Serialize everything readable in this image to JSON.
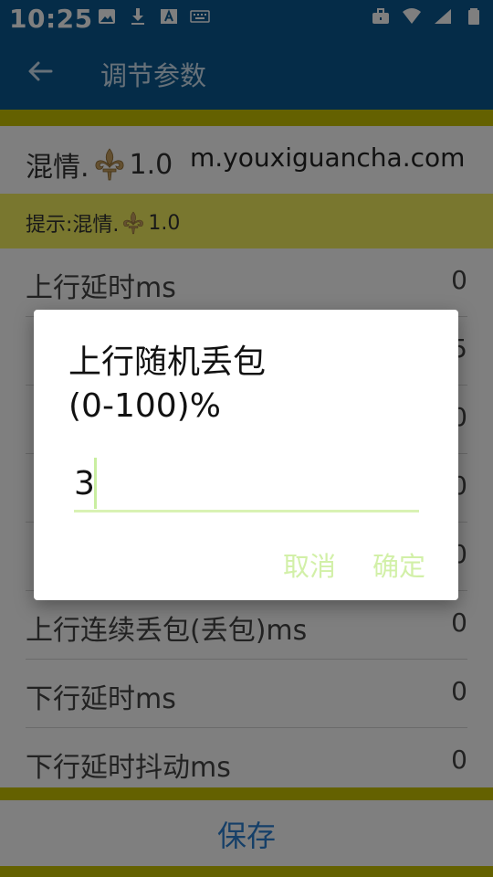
{
  "status_bar": {
    "time": "10:25",
    "left_icons": [
      "image-icon",
      "download-icon",
      "font-icon",
      "keyboard-icon"
    ],
    "right_icons": [
      "briefcase-icon",
      "wifi-icon",
      "signal-icon",
      "battery-icon"
    ]
  },
  "app_bar": {
    "title": "调节参数"
  },
  "header": {
    "title_prefix": "混情.",
    "title_version": "1.0",
    "site": "m.youxiguancha.com"
  },
  "hint": {
    "prefix": "提示:混情.",
    "version": "1.0"
  },
  "rows": [
    {
      "label": "上行延时ms",
      "value": "0"
    },
    {
      "label": "",
      "value": "5"
    },
    {
      "label": "",
      "value": "0"
    },
    {
      "label": "",
      "value": "0"
    },
    {
      "label": "",
      "value": "0"
    },
    {
      "label": "上行连续丢包(丢包)ms",
      "value": "0"
    },
    {
      "label": "下行延时ms",
      "value": "0"
    },
    {
      "label": "下行延时抖动ms",
      "value": "0"
    }
  ],
  "save_label": "保存",
  "dialog": {
    "title_line1": "上行随机丢包",
    "title_line2": "(0-100)%",
    "input_value": "3",
    "cancel_label": "取消",
    "ok_label": "确定"
  },
  "colors": {
    "primary": "#0a5890",
    "accent_strip": "#c9c300",
    "hint_bg": "#f2ef5f",
    "save_text": "#2a7fd0",
    "dialog_button": "#d2f0a8"
  }
}
